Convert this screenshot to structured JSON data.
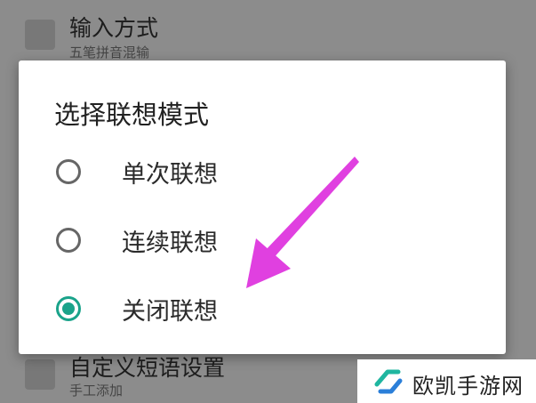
{
  "background": {
    "top_item": {
      "title": "输入方式",
      "subtitle": "五笔拼音混输"
    },
    "bottom_item": {
      "title": "自定义短语设置",
      "subtitle": "手工添加"
    }
  },
  "dialog": {
    "title": "选择联想模式",
    "options": [
      {
        "label": "单次联想",
        "selected": false
      },
      {
        "label": "连续联想",
        "selected": false
      },
      {
        "label": "关闭联想",
        "selected": true
      }
    ]
  },
  "colors": {
    "accent": "#1aa38a",
    "annotation_arrow": "#e040e0"
  },
  "watermark": {
    "text": "欧凯手游网",
    "logo_icon": "ok-logo-icon"
  }
}
